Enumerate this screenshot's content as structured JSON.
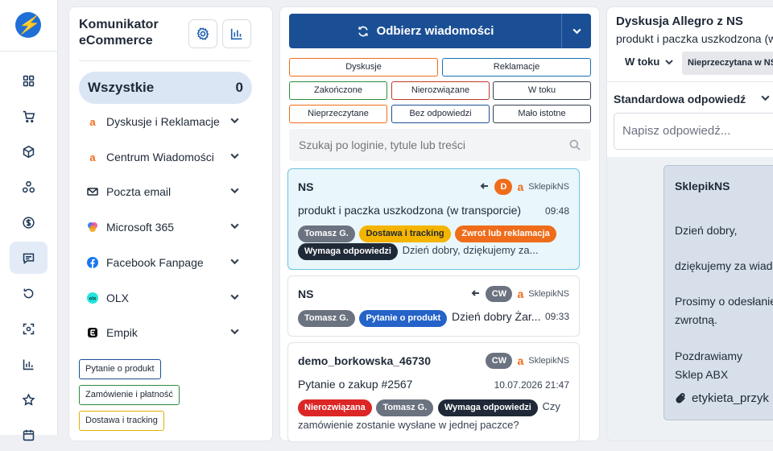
{
  "sidebar": {
    "title": "Komunikator eCommerce",
    "all_label": "Wszystkie",
    "all_count": "0",
    "sources": [
      {
        "label": "Dyskusje i Reklamacje",
        "icon": "allegro-icon"
      },
      {
        "label": "Centrum Wiadomości",
        "icon": "allegro-icon"
      },
      {
        "label": "Poczta email",
        "icon": "mail-icon"
      },
      {
        "label": "Microsoft 365",
        "icon": "copilot-icon"
      },
      {
        "label": "Facebook Fanpage",
        "icon": "facebook-icon"
      },
      {
        "label": "OLX",
        "icon": "olx-icon"
      },
      {
        "label": "Empik",
        "icon": "empik-icon"
      }
    ],
    "tags": [
      {
        "label": "Pytanie o produkt",
        "color": "#1b4f95"
      },
      {
        "label": "Zamówienie i płatność",
        "color": "#2e8b3a"
      },
      {
        "label": "Dostawa i tracking",
        "color": "#e0b000"
      }
    ]
  },
  "toolbar": {
    "fetch_label": "Odbierz wiadomości"
  },
  "filters": [
    {
      "label": "Dyskusje",
      "color": "#ef6c1a"
    },
    {
      "label": "Reklamacje",
      "color": "#1b6fae"
    },
    {
      "label": "Zakończone",
      "color": "#2e8b3a"
    },
    {
      "label": "Nierozwiązane",
      "color": "#c0392b"
    },
    {
      "label": "W toku",
      "color": "#374151"
    },
    {
      "label": "Nieprzeczytane",
      "color": "#ef6c1a"
    },
    {
      "label": "Bez odpowiedzi",
      "color": "#1b4f95"
    },
    {
      "label": "Mało istotne",
      "color": "#374151"
    }
  ],
  "search": {
    "placeholder": "Szukaj po loginie, tytule lub treści"
  },
  "conversations": [
    {
      "name": "NS",
      "badge": "D",
      "shop": "SklepikNS",
      "subject": "produkt i paczka uszkodzona (w transporcie)",
      "time": "09:48",
      "pills": [
        "Tomasz G.",
        "Dostawa i tracking",
        "Zwrot lub reklamacja",
        "Wymaga odpowiedzi"
      ],
      "preview": "Dzień dobry, dziękujemy za..."
    },
    {
      "name": "NS",
      "badge": "CW",
      "shop": "SklepikNS",
      "pills": [
        "Tomasz G.",
        "Pytanie o produkt"
      ],
      "preview": "Dzień dobry Żar...",
      "time": "09:33"
    },
    {
      "name": "demo_borkowska_46730",
      "badge": "CW",
      "shop": "SklepikNS",
      "subject": "Pytanie o zakup #2567",
      "time": "10.07.2026 21:47",
      "pills": [
        "Nierozwiązana",
        "Tomasz G.",
        "Wymaga odpowiedzi"
      ],
      "preview": "Czy zamówienie zostanie wysłane w jednej paczce?"
    }
  ],
  "detail": {
    "title": "Dyskusja Allegro z NS",
    "subtitle": "produkt i paczka uszkodzona (w",
    "status": "W toku",
    "tag": "Nieprzeczytana w NS",
    "std_reply_label": "Standardowa odpowiedź",
    "reply_placeholder": "Napisz odpowiedź...",
    "message": {
      "from": "SklepikNS",
      "lines": [
        "Dzień dobry,",
        "dziękujemy za wiado",
        "Prosimy o odesłanie",
        "zwrotną.",
        "Pozdrawiamy",
        "Sklep ABX"
      ],
      "attachment": "etykieta_przyk"
    }
  }
}
